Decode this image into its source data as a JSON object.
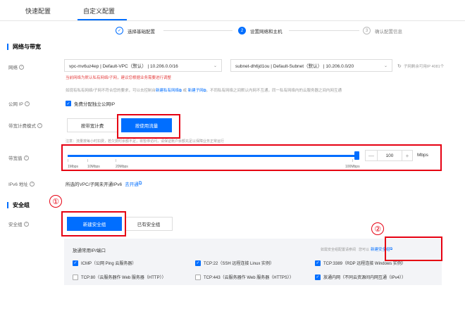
{
  "tabs": [
    {
      "label": "快速配置"
    },
    {
      "label": "自定义配置"
    }
  ],
  "steps": [
    {
      "num": "✓",
      "label": "选择基础配置"
    },
    {
      "num": "2",
      "label": "设置网络和主机"
    },
    {
      "num": "3",
      "label": "确认配置信息"
    }
  ],
  "network": {
    "section_title": "网络与带宽",
    "label": "网络",
    "vpc_value": "vpc-mv6uz4ep | Default-VPC（默认） | 10.206.0.0/16",
    "subnet_value": "subnet-dh6jd1ou | Default-Subnet（默认） | 10.206.0.0/20",
    "refresh_note": "子网剩余可用IP 4081个",
    "red_note": "当前网络为默认私有网络/子网，建议您根据业务需要进行调整",
    "gray_note_pre": "如现有私有网络/子网不符合您的要求，可以去控制台",
    "link_vpc": "新建私有网络",
    "mid": "或",
    "link_subnet": "新建子网",
    "gray_note_post": "，不同私有网络之间默认内网不互通，同一私有网络内的云服务器之间内网互通"
  },
  "public_ip": {
    "label": "公网 IP",
    "checkbox_label": "免费分配独立公网IP"
  },
  "billing": {
    "label": "带宽计费模式",
    "option_bandwidth": "按带宽计费",
    "option_traffic": "按使用流量",
    "note": "注意：流量按每小时扣费，若欠费时余额不足，将暂停访问，请保证账户余额充足以保障业务正常运行"
  },
  "bandwidth": {
    "label": "带宽值",
    "value": "100",
    "unit": "Mbps",
    "minus": "—",
    "plus": "+",
    "ticks": [
      "1Mbps",
      "10Mbps",
      "20Mbps",
      "100Mbps"
    ]
  },
  "ipv6": {
    "label": "IPv6 地址",
    "text": "所选的VPC/子网未开通IPv6",
    "link": "去开通"
  },
  "security": {
    "section_title": "安全组",
    "label": "安全组",
    "btn_new": "新建安全组",
    "btn_existing": "已有安全组",
    "ports_title": "放通常用IP/端口",
    "right_note": "如需安全组配置请参阅",
    "right_link_pre": "您可以",
    "new_sg_link": "新建安全组",
    "ports": [
      {
        "label": "ICMP（公网 Ping 云服务器）",
        "checked": true
      },
      {
        "label": "TCP:22（SSH 远程连接 Linux 实例）",
        "checked": true
      },
      {
        "label": "TCP:3389（RDP 远程连接 Windows 实例）",
        "checked": true
      },
      {
        "label": "TCP:80（云服务器作 Web 服务器（HTTP））",
        "checked": false
      },
      {
        "label": "TCP:443（云服务器作 Web 服务器（HTTPS））",
        "checked": false
      },
      {
        "label": "放通内网（不同云资源间内网互通（IPv4））",
        "checked": true
      }
    ]
  },
  "annotations": {
    "num1": "①",
    "num2": "②"
  },
  "colors": {
    "accent": "#006eff",
    "annotation_red": "#e60012",
    "error_red": "#e54545"
  }
}
